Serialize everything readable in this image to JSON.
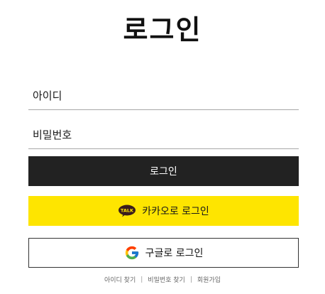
{
  "title": "로그인",
  "form": {
    "id_placeholder": "아이디",
    "password_placeholder": "비밀번호"
  },
  "buttons": {
    "login_label": "로그인",
    "kakao_label": "카카오로 로그인",
    "kakao_icon_text": "TALK",
    "google_label": "구글로 로그인"
  },
  "links": {
    "find_id": "아이디 찾기",
    "find_password": "비밀번호 찾기",
    "signup": "회원가입",
    "separator": "|"
  },
  "icons": {
    "kakao": "kakao-talk-icon",
    "google": "google-logo-icon"
  },
  "colors": {
    "login_button": "#222222",
    "kakao_yellow": "#fee500",
    "text": "#111111"
  }
}
